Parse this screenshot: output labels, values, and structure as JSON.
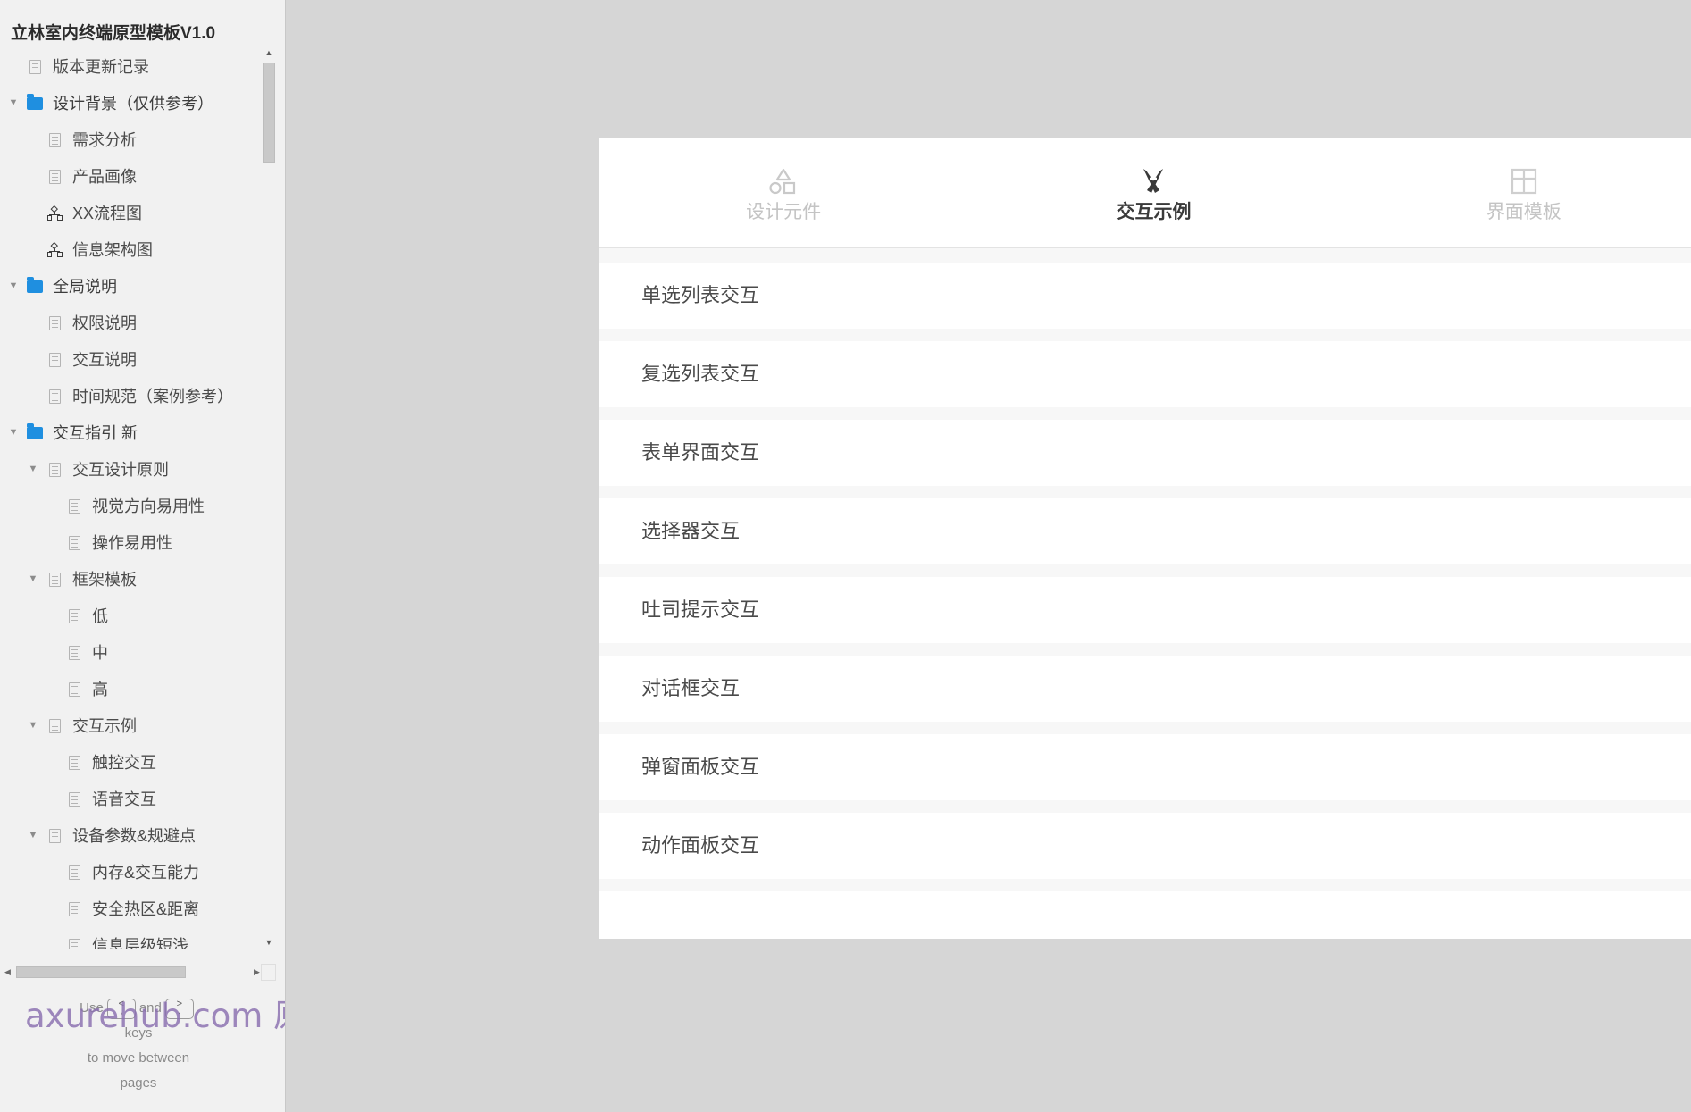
{
  "sidebar": {
    "title": "立林室内终端原型模板V1.0",
    "tree": [
      {
        "label": "版本更新记录",
        "icon": "page-icon",
        "level": 0,
        "arrow": "none"
      },
      {
        "label": "设计背景（仅供参考）",
        "icon": "folder-icon",
        "level": 0,
        "arrow": "down"
      },
      {
        "label": "需求分析",
        "icon": "page-icon",
        "level": 1,
        "arrow": "none"
      },
      {
        "label": "产品画像",
        "icon": "page-icon",
        "level": 1,
        "arrow": "none"
      },
      {
        "label": "XX流程图",
        "icon": "flow-chart-icon",
        "level": 1,
        "arrow": "none"
      },
      {
        "label": "信息架构图",
        "icon": "flow-chart-icon",
        "level": 1,
        "arrow": "none"
      },
      {
        "label": "全局说明",
        "icon": "folder-icon",
        "level": 0,
        "arrow": "down"
      },
      {
        "label": "权限说明",
        "icon": "page-icon",
        "level": 1,
        "arrow": "none"
      },
      {
        "label": "交互说明",
        "icon": "page-icon",
        "level": 1,
        "arrow": "none"
      },
      {
        "label": "时间规范（案例参考）",
        "icon": "page-icon",
        "level": 1,
        "arrow": "none"
      },
      {
        "label": "交互指引 新",
        "icon": "folder-icon",
        "level": 0,
        "arrow": "down"
      },
      {
        "label": "交互设计原则",
        "icon": "page-icon",
        "level": 1,
        "arrow": "down"
      },
      {
        "label": "视觉方向易用性",
        "icon": "page-icon",
        "level": 2,
        "arrow": "none"
      },
      {
        "label": "操作易用性",
        "icon": "page-icon",
        "level": 2,
        "arrow": "none"
      },
      {
        "label": "框架模板",
        "icon": "page-icon",
        "level": 1,
        "arrow": "down"
      },
      {
        "label": "低",
        "icon": "page-icon",
        "level": 2,
        "arrow": "none"
      },
      {
        "label": "中",
        "icon": "page-icon",
        "level": 2,
        "arrow": "none"
      },
      {
        "label": "高",
        "icon": "page-icon",
        "level": 2,
        "arrow": "none"
      },
      {
        "label": "交互示例",
        "icon": "page-icon",
        "level": 1,
        "arrow": "down"
      },
      {
        "label": "触控交互",
        "icon": "page-icon",
        "level": 2,
        "arrow": "none"
      },
      {
        "label": "语音交互",
        "icon": "page-icon",
        "level": 2,
        "arrow": "none"
      },
      {
        "label": "设备参数&规避点",
        "icon": "page-icon",
        "level": 1,
        "arrow": "down"
      },
      {
        "label": "内存&交互能力",
        "icon": "page-icon",
        "level": 2,
        "arrow": "none"
      },
      {
        "label": "安全热区&距离",
        "icon": "page-icon",
        "level": 2,
        "arrow": "none"
      },
      {
        "label": "信息层级短浅",
        "icon": "page-icon",
        "level": 2,
        "arrow": "none"
      }
    ],
    "scroll": {
      "up_arrow": "▲",
      "down_arrow": "▼",
      "left_arrow": "◀",
      "right_arrow": "▶"
    },
    "keyboard_hint": {
      "prefix": "Use",
      "key_prev_top": "<",
      "key_prev_bottom": ",",
      "joiner": "and",
      "key_next_top": ">",
      "key_next_bottom": ".",
      "suffix_line1": "keys",
      "suffix_line2": "to move between",
      "suffix_line3": "pages"
    },
    "watermark": "axurehub.com 原型资源站"
  },
  "prototype": {
    "tabs": [
      {
        "label": "设计元件",
        "icon": "shapes-icon",
        "active": false
      },
      {
        "label": "交互示例",
        "icon": "crossed-pencils-icon",
        "active": true
      },
      {
        "label": "界面模板",
        "icon": "grid-layout-icon",
        "active": false
      }
    ],
    "list": [
      {
        "label": "单选列表交互"
      },
      {
        "label": "复选列表交互"
      },
      {
        "label": "表单界面交互"
      },
      {
        "label": "选择器交互"
      },
      {
        "label": "吐司提示交互"
      },
      {
        "label": "对话框交互"
      },
      {
        "label": "弹窗面板交互"
      },
      {
        "label": "动作面板交互"
      },
      {
        "label": ""
      }
    ]
  },
  "colors": {
    "canvas_bg": "#d6d6d6",
    "sidebar_bg": "#f1f1f1",
    "panel_bg": "#f7f7f7",
    "card_bg": "#ffffff",
    "folder_blue": "#1f8fe0",
    "active_tab": "#3a3a3a",
    "inactive_tab": "#c4c4c4",
    "watermark": "#8a6fb0"
  }
}
